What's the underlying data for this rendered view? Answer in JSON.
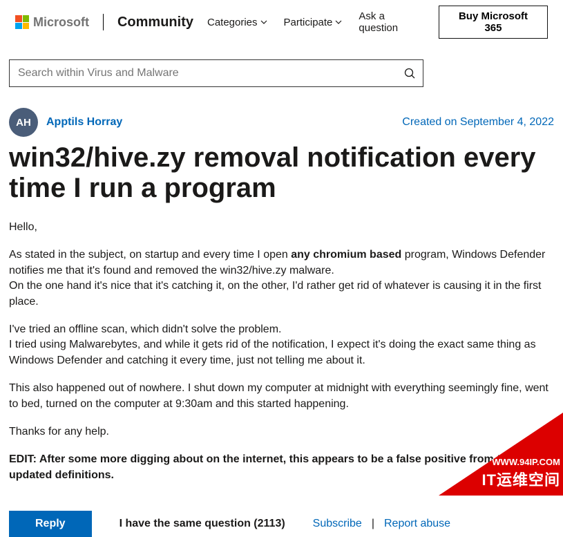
{
  "header": {
    "brand": "Microsoft",
    "community": "Community",
    "nav": {
      "categories": "Categories",
      "participate": "Participate",
      "ask": "Ask a question"
    },
    "buy": "Buy Microsoft 365"
  },
  "search": {
    "placeholder": "Search within Virus and Malware"
  },
  "post": {
    "avatar_initials": "AH",
    "author": "Apptils Horray",
    "created": "Created on September 4, 2022",
    "title": "win32/hive.zy removal notification every time I run a program",
    "body": {
      "p1": "Hello,",
      "p2a": "As stated in the subject, on startup and every time I open ",
      "p2b": "any chromium based",
      "p2c": " program, Windows Defender notifies me that it's found and removed the win32/hive.zy malware.",
      "p3": "On the one hand it's nice that it's catching it, on the other, I'd rather get rid of whatever is causing it in the first place.",
      "p4": "I've tried an offline scan, which didn't solve the problem.",
      "p5": "I tried using Malwarebytes, and while it gets rid of the notification, I expect it's doing the exact same thing as Windows Defender and catching it every time, just not telling me about it.",
      "p6": "This also happened out of nowhere. I shut down my computer at midnight with everything seemingly fine, went to bed, turned on the computer at 9:30am and this started happening.",
      "p7": "Thanks for any help.",
      "p8": "EDIT: After some more digging about on the internet, this appears to be a false positive from today's updated definitions."
    }
  },
  "actions": {
    "reply": "Reply",
    "same_question": "I have the same question (2113)",
    "subscribe": "Subscribe",
    "sep": "|",
    "report": "Report abuse"
  },
  "overlay": {
    "line1": "WWW.94IP.COM",
    "line2": "IT运维空间"
  }
}
